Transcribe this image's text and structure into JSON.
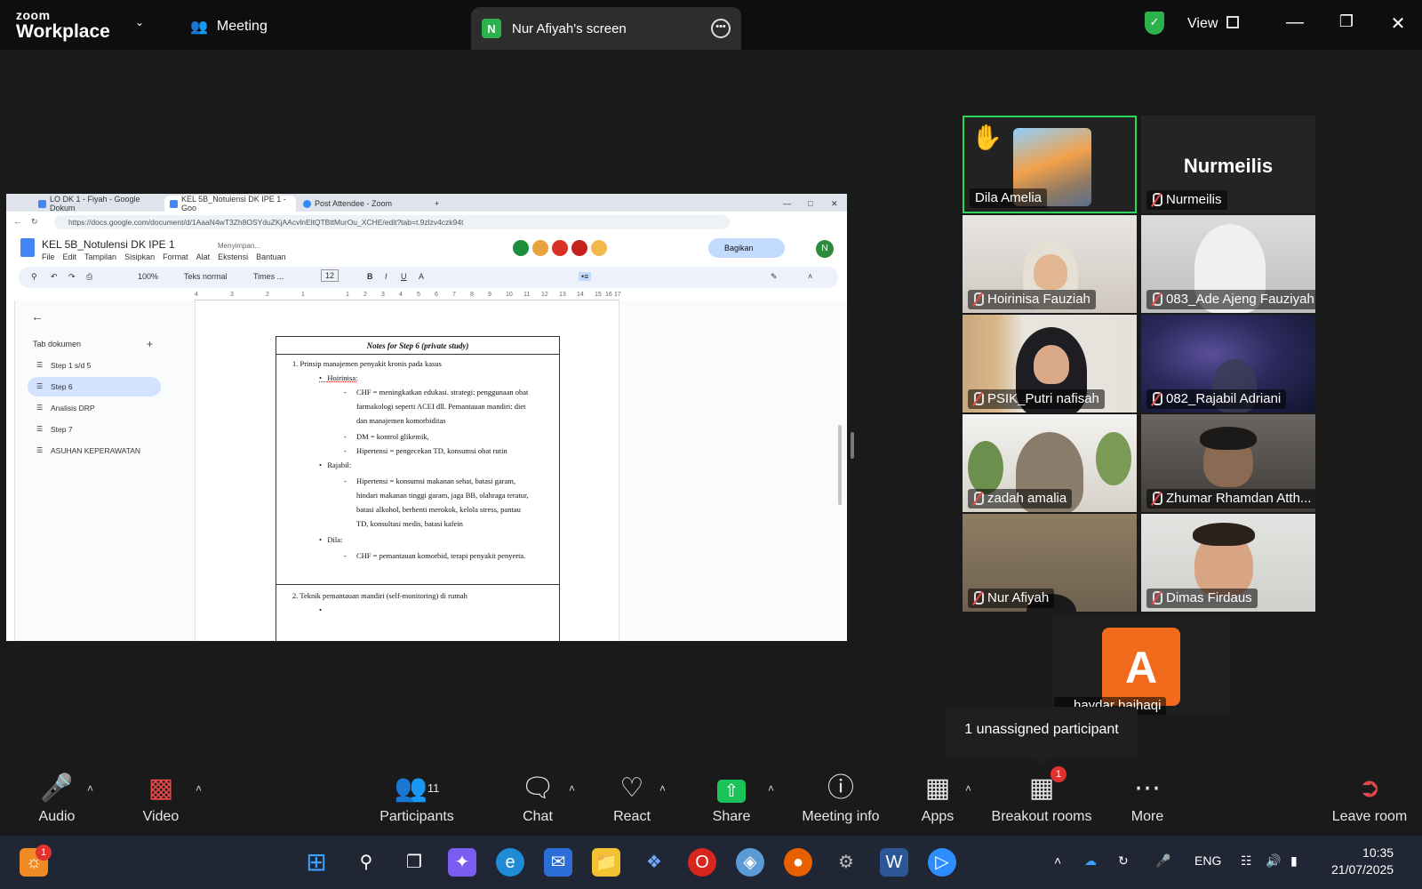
{
  "topbar": {
    "logo_line1": "zoom",
    "logo_line2": "Workplace",
    "meeting_label": "Meeting",
    "share_badge": "N",
    "share_tab_label": "Nur Afiyah's screen",
    "view_label": "View"
  },
  "browser": {
    "tabs": [
      {
        "label": "LO DK 1 - Fiyah - Google Dokum"
      },
      {
        "label": "KEL 5B_Notulensi DK IPE 1 - Goo"
      },
      {
        "label": "Post Attendee - Zoom"
      }
    ],
    "url": "https://docs.google.com/document/d/1AaaN4wT3Zh8OSYduZKjAAcvlnEltQTBttMurOu_XCHE/edit?tab=t.9zlzv4czk94t"
  },
  "docs": {
    "title": "KEL 5B_Notulensi DK IPE 1",
    "saving": "Menyimpan...",
    "menu": [
      "File",
      "Edit",
      "Tampilan",
      "Sisipkan",
      "Format",
      "Alat",
      "Ekstensi",
      "Bantuan"
    ],
    "share_label": "Bagikan",
    "avatar": "N",
    "toolbar": {
      "zoom": "100%",
      "style": "Teks normal",
      "font": "Times ...",
      "size": "12"
    },
    "ruler": [
      "4",
      "3",
      "2",
      "1",
      "1",
      "2",
      "3",
      "4",
      "5",
      "6",
      "7",
      "8",
      "9",
      "10",
      "11",
      "12",
      "13",
      "14",
      "15",
      "16",
      "17"
    ],
    "sidebar_title": "Tab dokumen",
    "sidebar_tabs": [
      "Step 1 s/d 5",
      "Step 6",
      "Analisis DRP",
      "Step 7",
      "ASUHAN KEPERAWATAN"
    ],
    "table_title": "Notes for Step 6 (private study)",
    "content": {
      "item1": "1.    Prinsip manajemen penyakit kronis pada kasus",
      "hoirinisa": "Hoirinisa:",
      "chf1a": "CHF = meningkatkan edukasi. strategi: penggunaan obat",
      "chf1b": "farmakologi seperti ACEI dll. Pemantauan mandiri: diet",
      "chf1c": "dan manajemen komorbiditas",
      "dm": "DM = kontrol glikemik,",
      "hip1": "Hipertensi = pengecekan TD, konsumsi obat rutin",
      "rajabil": "Rajabil:",
      "hip2a": "Hipertensi = konsumsi makanan sehat, batasi garam,",
      "hip2b": "hindari makanan tinggi garam, jaga BB, olahraga teratur,",
      "hip2c": "batasi alkohol, berhenti merokok, kelola stress, pantau",
      "hip2d": "TD, konsultasi medis, batasi kafein",
      "dila": "Dila:",
      "chf2": "CHF = pemantauan komorbid, terapi penyakit penyerta.",
      "item2": "2.    Teknik pemantauan mandiri (self-monitoring) di rumah"
    }
  },
  "participants": [
    {
      "name": "Dila Amelia"
    },
    {
      "name": "Nurmeilis",
      "display": "Nurmeilis"
    },
    {
      "name": "Hoirinisa Fauziah"
    },
    {
      "name": "083_Ade Ajeng Fauziyah"
    },
    {
      "name": "PSIK_Putri nafisah"
    },
    {
      "name": "082_Rajabil Adriani"
    },
    {
      "name": "zadah amalia"
    },
    {
      "name": "Zhumar Rhamdan Atth..."
    },
    {
      "name": "Nur Afiyah"
    },
    {
      "name": "Dimas Firdaus"
    },
    {
      "name": "haydar baihaqi",
      "initial": "A"
    }
  ],
  "tooltip": "1 unassigned participant",
  "controls": {
    "audio": "Audio",
    "video": "Video",
    "participants": "Participants",
    "participants_count": "11",
    "chat": "Chat",
    "react": "React",
    "share": "Share",
    "meeting_info": "Meeting info",
    "apps": "Apps",
    "breakout": "Breakout rooms",
    "breakout_badge": "1",
    "more": "More",
    "leave": "Leave room"
  },
  "taskbar": {
    "widget_badge": "1",
    "lang": "ENG",
    "time": "10:35",
    "date": "21/07/2025"
  },
  "colors": {
    "zoom_green": "#2bd85a",
    "share_green": "#19c35a",
    "badge_red": "#e0322e",
    "docs_blue": "#4285f4"
  }
}
